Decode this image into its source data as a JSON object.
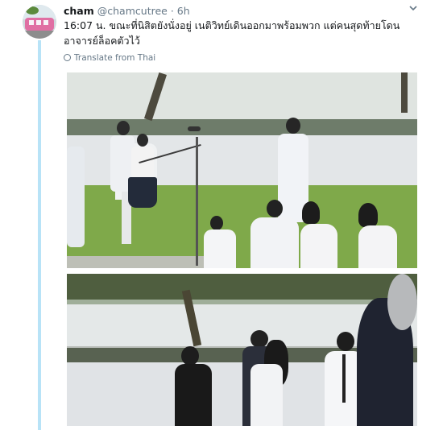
{
  "tweet": {
    "author_name": "cham",
    "author_handle": "@chamcutree",
    "separator": "·",
    "timestamp": "6h",
    "text": "16:07 น. ขณะที่นิสิตยังนั่งอยู่ เนติวิทย์เดินออกมาพร้อมพวก แต่คนสุดท้ายโดนอาจารย์ล็อคตัวไว้",
    "translate_label": "Translate from Thai",
    "caret_icon": "chevron-down-icon"
  },
  "colors": {
    "thread_line": "#b8e3f7",
    "secondary_text": "#657786",
    "primary_text": "#14171a"
  }
}
